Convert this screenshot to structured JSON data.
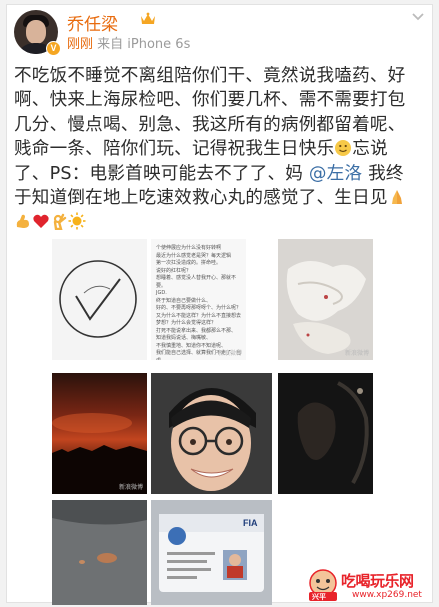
{
  "post": {
    "username": "乔任梁",
    "time": "刚刚",
    "source": "来自 iPhone 6s",
    "text_before_mention": "不吃饭不睡觉不离组陪你们干、竟然说我嗑药、好啊、快来上海尿检吧、你们要几杯、需不需要打包几分、慢点喝、别急、我这所有的病例都留着呢、贱命一条、陪你们玩、记得祝我生日快乐",
    "text_mid": "忘说了、PS：电影首映可能去不了了、妈 ",
    "mention": "@左洛",
    "text_after_mention": " 我终于知道倒在地上吃速效救心丸的感觉了、生日见",
    "emojis": [
      "smile-emoji",
      "pray-emoji",
      "muscle-emoji",
      "heart-emoji",
      "ok-hand-emoji",
      "sun-emoji"
    ]
  },
  "images": {
    "text_note_lines": [
      "个使伸展应为什么没有好转啊",
      "最近为什么感觉老是哭？每天逻辑",
      "第一次扛没造成的。拼命哇。",
      "说好的红杠呢？",
      "想睡着、感觉没人替我开心、那就不要。",
      "JGD.",
      "终于知道自己要做什么、",
      "好的、不要再呀那呀呀个、为什么呢？",
      "又为什么不能这样？为什么不直接想去",
      "梦想？为什么会觉得这样？",
      "打死不能说拿出来、我都那么不那、",
      "知道我妈说话、梅嘴敏、",
      "不我慎重地、知道你不知道呢、",
      "我们能自己选择、就算我们不走了、自虐、",
      "傲慢、虚伪、敏感、爱自己、爱迟程、爱说",
      "友、爱未来、",
      "千万别学我、",
      "拼搏老是赢喽"
    ],
    "weibo_watermarks": [
      "新浪微博",
      "新浪微博",
      "新浪微博"
    ],
    "id_card_label": "FIA",
    "selfie_bg_text": ""
  },
  "site_logo": {
    "name": "吃喝玩乐网",
    "url": "www.xp269.net",
    "badge_text": "兴平"
  },
  "colors": {
    "username": "#e86b0e",
    "link": "#3b6ea5",
    "logo": "#e8232a"
  }
}
